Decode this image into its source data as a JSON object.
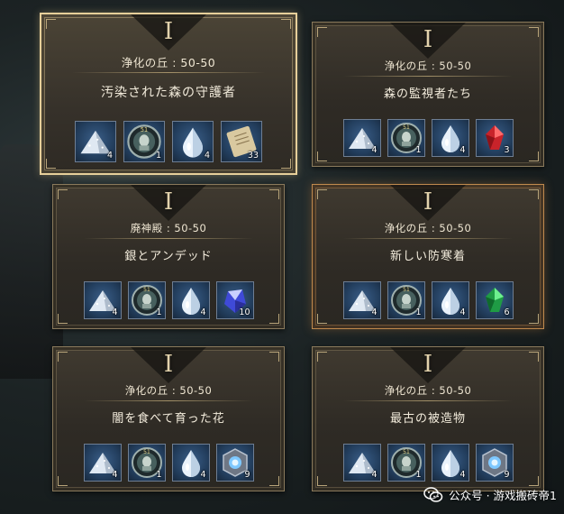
{
  "cards": [
    {
      "tier": "I",
      "region": "浄化の丘 : 50-50",
      "quest": "汚染された森の守護者",
      "items": [
        {
          "icon": "silver-powder-icon",
          "count": "4"
        },
        {
          "icon": "guardian-orb-icon",
          "count": "1"
        },
        {
          "icon": "water-drop-icon",
          "count": "4"
        },
        {
          "icon": "scroll-icon",
          "count": "33"
        }
      ]
    },
    {
      "tier": "I",
      "region": "浄化の丘 : 50-50",
      "quest": "森の監視者たち",
      "items": [
        {
          "icon": "silver-powder-icon",
          "count": "4"
        },
        {
          "icon": "guardian-orb-icon",
          "count": "1"
        },
        {
          "icon": "water-drop-icon",
          "count": "4"
        },
        {
          "icon": "red-gem-icon",
          "count": "3"
        }
      ]
    },
    {
      "tier": "I",
      "region": "廃神殿 : 50-50",
      "quest": "銀とアンデッド",
      "items": [
        {
          "icon": "silver-powder-icon",
          "count": "4"
        },
        {
          "icon": "guardian-orb-icon",
          "count": "1"
        },
        {
          "icon": "water-drop-icon",
          "count": "4"
        },
        {
          "icon": "blue-crystal-icon",
          "count": "10"
        }
      ]
    },
    {
      "tier": "I",
      "region": "浄化の丘 : 50-50",
      "quest": "新しい防寒着",
      "items": [
        {
          "icon": "silver-powder-icon",
          "count": "4"
        },
        {
          "icon": "guardian-orb-icon",
          "count": "1"
        },
        {
          "icon": "water-drop-icon",
          "count": "4"
        },
        {
          "icon": "green-gem-icon",
          "count": "6"
        }
      ]
    },
    {
      "tier": "I",
      "region": "浄化の丘 : 50-50",
      "quest": "闇を食べて育った花",
      "items": [
        {
          "icon": "silver-powder-icon",
          "count": "4"
        },
        {
          "icon": "guardian-orb-icon",
          "count": "1"
        },
        {
          "icon": "water-drop-icon",
          "count": "4"
        },
        {
          "icon": "rune-stone-icon",
          "count": "9"
        }
      ]
    },
    {
      "tier": "I",
      "region": "浄化の丘 : 50-50",
      "quest": "最古の被造物",
      "items": [
        {
          "icon": "silver-powder-icon",
          "count": "4"
        },
        {
          "icon": "guardian-orb-icon",
          "count": "1"
        },
        {
          "icon": "water-drop-icon",
          "count": "4"
        },
        {
          "icon": "rune-stone-icon",
          "count": "9"
        }
      ]
    }
  ],
  "watermark": {
    "text": "公众号 · 游戏搬砖帝1",
    "icon": "wechat-logo-icon"
  }
}
